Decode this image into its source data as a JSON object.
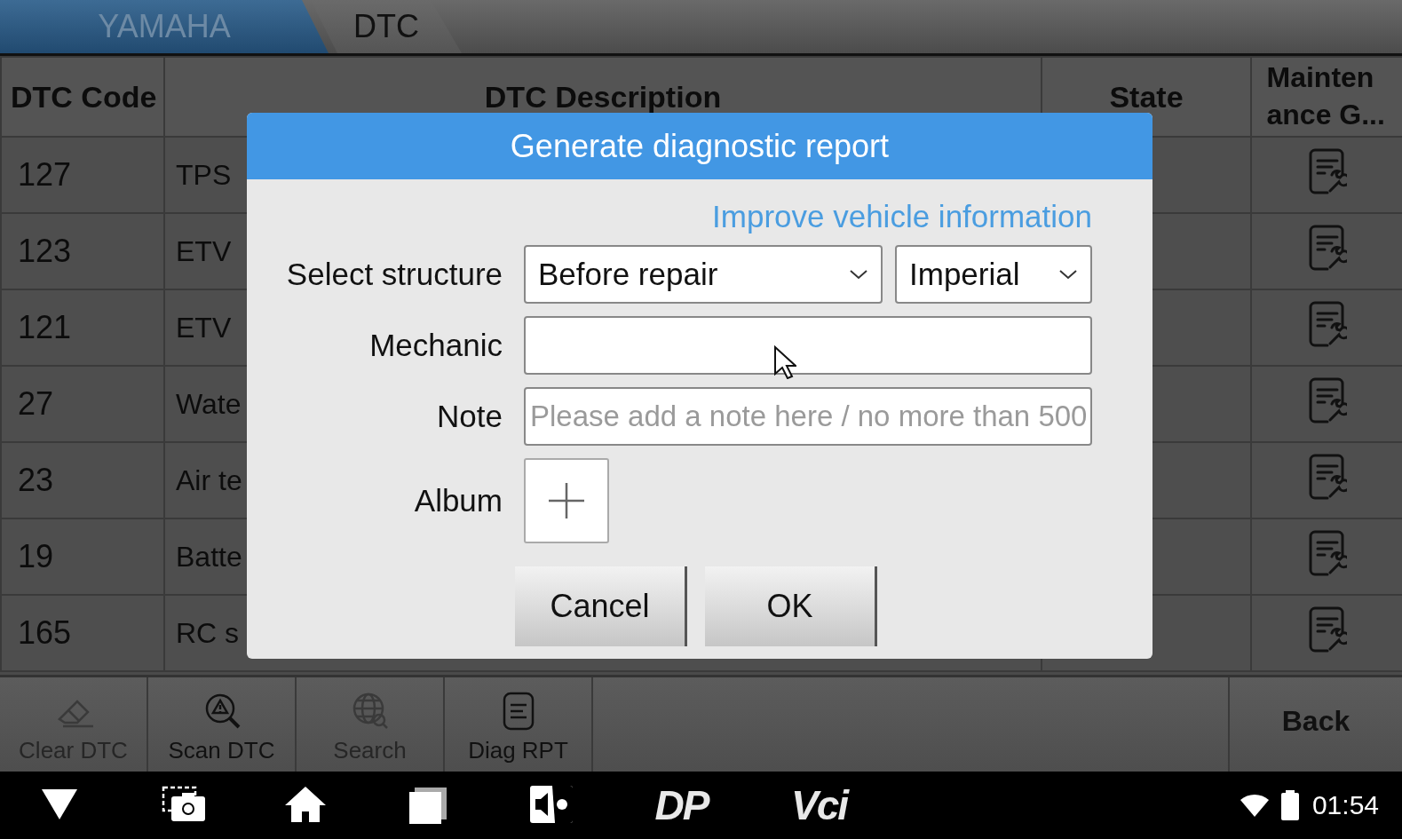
{
  "breadcrumbs": [
    {
      "label": "YAMAHA",
      "selected": true
    },
    {
      "label": "DTC",
      "selected": false
    }
  ],
  "table": {
    "columns": [
      "DTC Code",
      "DTC Description",
      "State",
      "Maintenance G..."
    ],
    "rows": [
      {
        "code": "127",
        "description": "TPS"
      },
      {
        "code": "123",
        "description": "ETV"
      },
      {
        "code": "121",
        "description": "ETV"
      },
      {
        "code": "27",
        "description": "Wate"
      },
      {
        "code": "23",
        "description": "Air te"
      },
      {
        "code": "19",
        "description": "Batte"
      },
      {
        "code": "165",
        "description": "RC s"
      }
    ]
  },
  "toolbar": {
    "buttons": [
      {
        "kind": "eraser",
        "label": "Clear DTC",
        "disabled": true
      },
      {
        "kind": "scan",
        "label": "Scan DTC",
        "disabled": false
      },
      {
        "kind": "globe",
        "label": "Search",
        "disabled": true
      },
      {
        "kind": "report",
        "label": "Diag RPT",
        "disabled": false
      }
    ],
    "back": "Back"
  },
  "dialog": {
    "title": "Generate diagnostic report",
    "link": "Improve vehicle information",
    "structure": {
      "label": "Select structure",
      "value": "Before repair",
      "unit": "Imperial"
    },
    "mechanic": {
      "label": "Mechanic"
    },
    "note": {
      "label": "Note",
      "placeholder": "Please add a note here / no more than 500"
    },
    "album": {
      "label": "Album"
    },
    "buttons": [
      "Cancel",
      "OK"
    ]
  },
  "nav_bar": {
    "logos": [
      "DP",
      "Vci"
    ],
    "time": "01:54"
  }
}
